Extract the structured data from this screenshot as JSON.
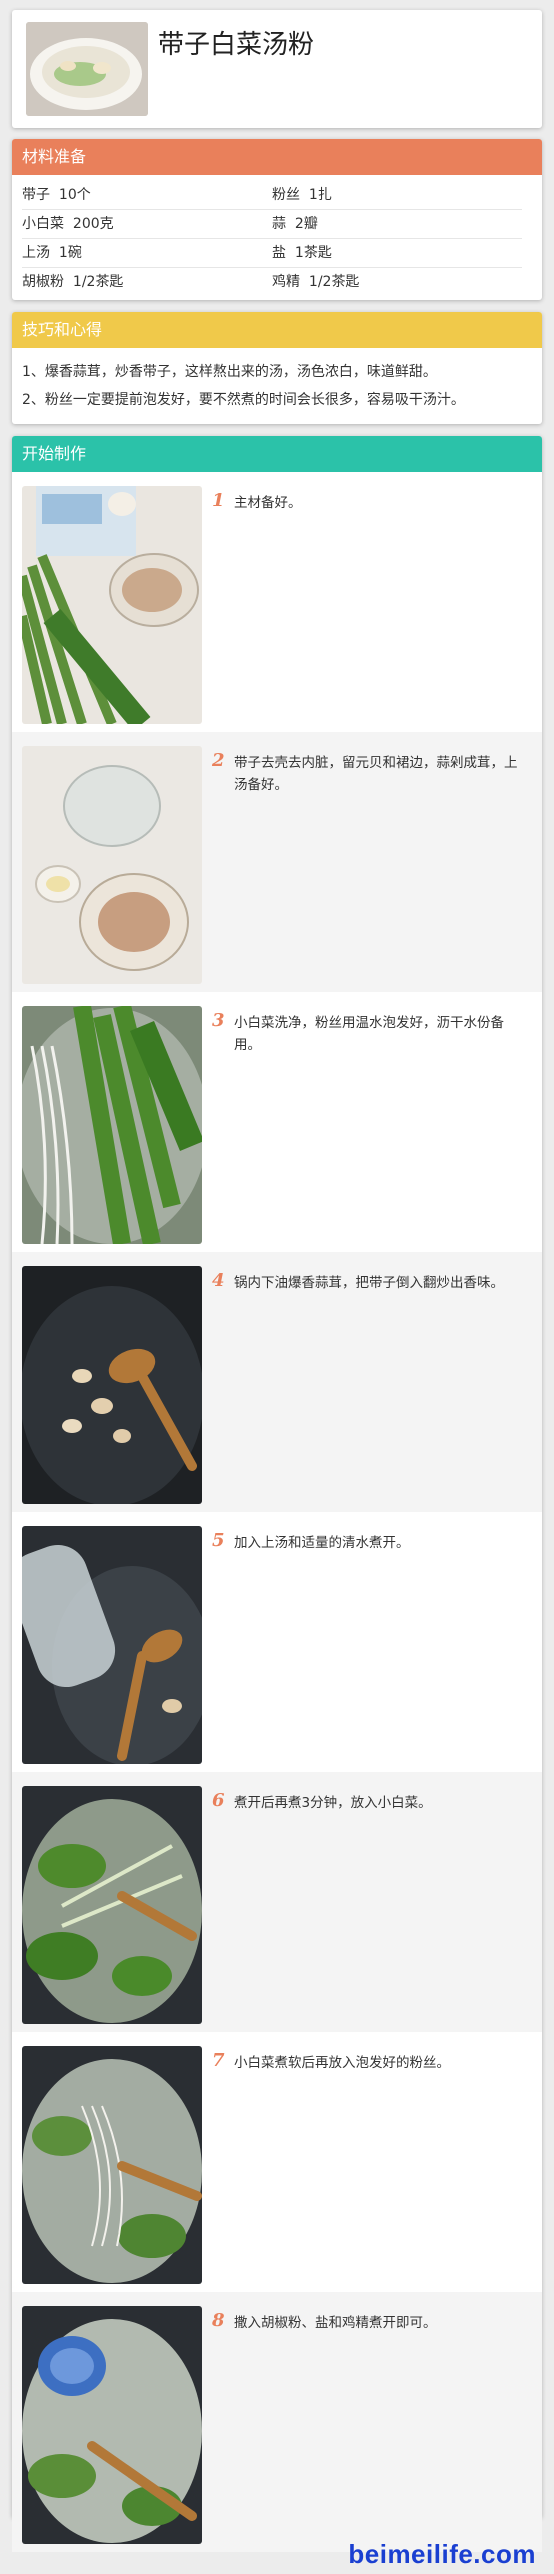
{
  "recipe": {
    "title": "带子白菜汤粉"
  },
  "ingredients": {
    "heading": "材料准备",
    "rows": [
      [
        {
          "name": "带子",
          "amount": "10个"
        },
        {
          "name": "粉丝",
          "amount": "1扎"
        }
      ],
      [
        {
          "name": "小白菜",
          "amount": "200克"
        },
        {
          "name": "蒜",
          "amount": "2瓣"
        }
      ],
      [
        {
          "name": "上汤",
          "amount": "1碗"
        },
        {
          "name": "盐",
          "amount": "1茶匙"
        }
      ],
      [
        {
          "name": "胡椒粉",
          "amount": "1/2茶匙"
        },
        {
          "name": "鸡精",
          "amount": "1/2茶匙"
        }
      ]
    ]
  },
  "tips": {
    "heading": "技巧和心得",
    "items": [
      "1、爆香蒜茸，炒香带子，这样熬出来的汤，汤色浓白，味道鲜甜。",
      "2、粉丝一定要提前泡发好，要不然煮的时间会长很多，容易吸干汤汁。"
    ]
  },
  "steps": {
    "heading": "开始制作",
    "items": [
      {
        "num": "1",
        "text": "主材备好。"
      },
      {
        "num": "2",
        "text": "带子去壳去内脏，留元贝和裙边，蒜剁成茸，上汤备好。"
      },
      {
        "num": "3",
        "text": "小白菜洗净，粉丝用温水泡发好，沥干水份备用。"
      },
      {
        "num": "4",
        "text": "锅内下油爆香蒜茸，把带子倒入翻炒出香味。"
      },
      {
        "num": "5",
        "text": "加入上汤和适量的清水煮开。"
      },
      {
        "num": "6",
        "text": "煮开后再煮3分钟，放入小白菜。"
      },
      {
        "num": "7",
        "text": "小白菜煮软后再放入泡发好的粉丝。"
      },
      {
        "num": "8",
        "text": "撒入胡椒粉、盐和鸡精煮开即可。"
      }
    ]
  },
  "footer": {
    "logo": "beimeilife.com"
  },
  "colors": {
    "ingredients_accent": "#e9805b",
    "tips_accent": "#f0c94a",
    "steps_accent": "#2bc2a9",
    "logo": "#1a3fd1"
  }
}
